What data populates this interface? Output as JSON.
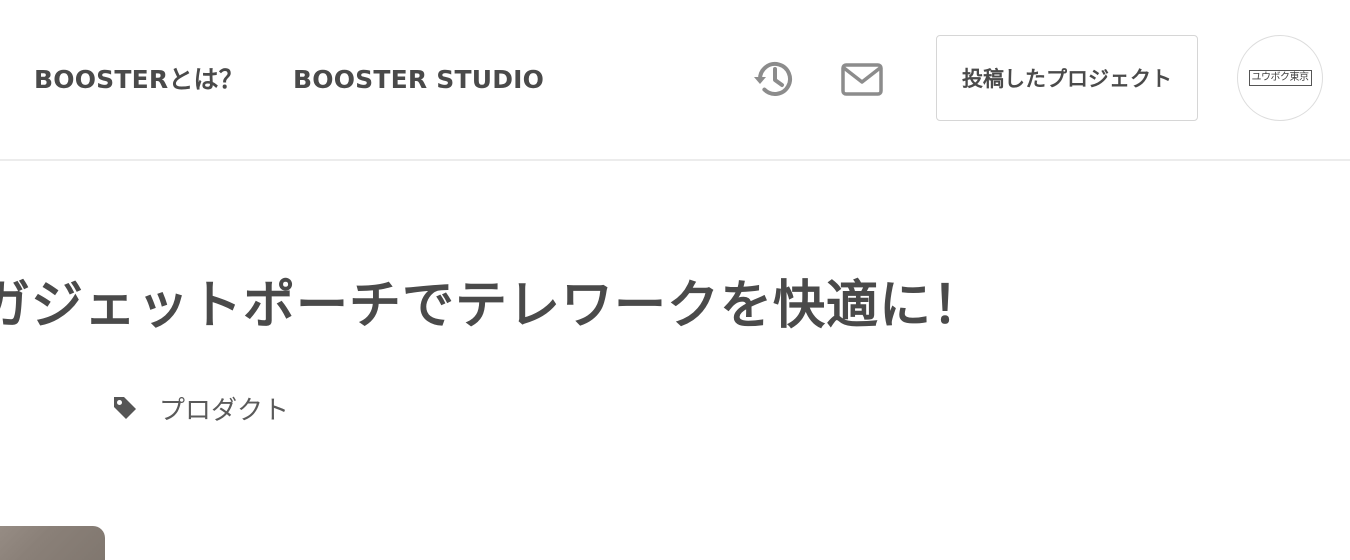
{
  "header": {
    "nav": {
      "about_label": "BOOSTERとは？",
      "studio_label": "BOOSTER STUDIO"
    },
    "icons": {
      "history": "history-icon",
      "mail": "mail-icon"
    },
    "posted_projects_label": "投稿したプロジェクト",
    "avatar_text": "ユウボク東京"
  },
  "project": {
    "title": "ガジェットポーチでテレワークを快適に！",
    "tag_icon": "tag-icon",
    "tag_label": "プロダクト"
  },
  "colors": {
    "text": "#4a4a4a",
    "border": "#d6d6d6",
    "divider": "#ececec",
    "icon_gray": "#8c8c8c"
  }
}
